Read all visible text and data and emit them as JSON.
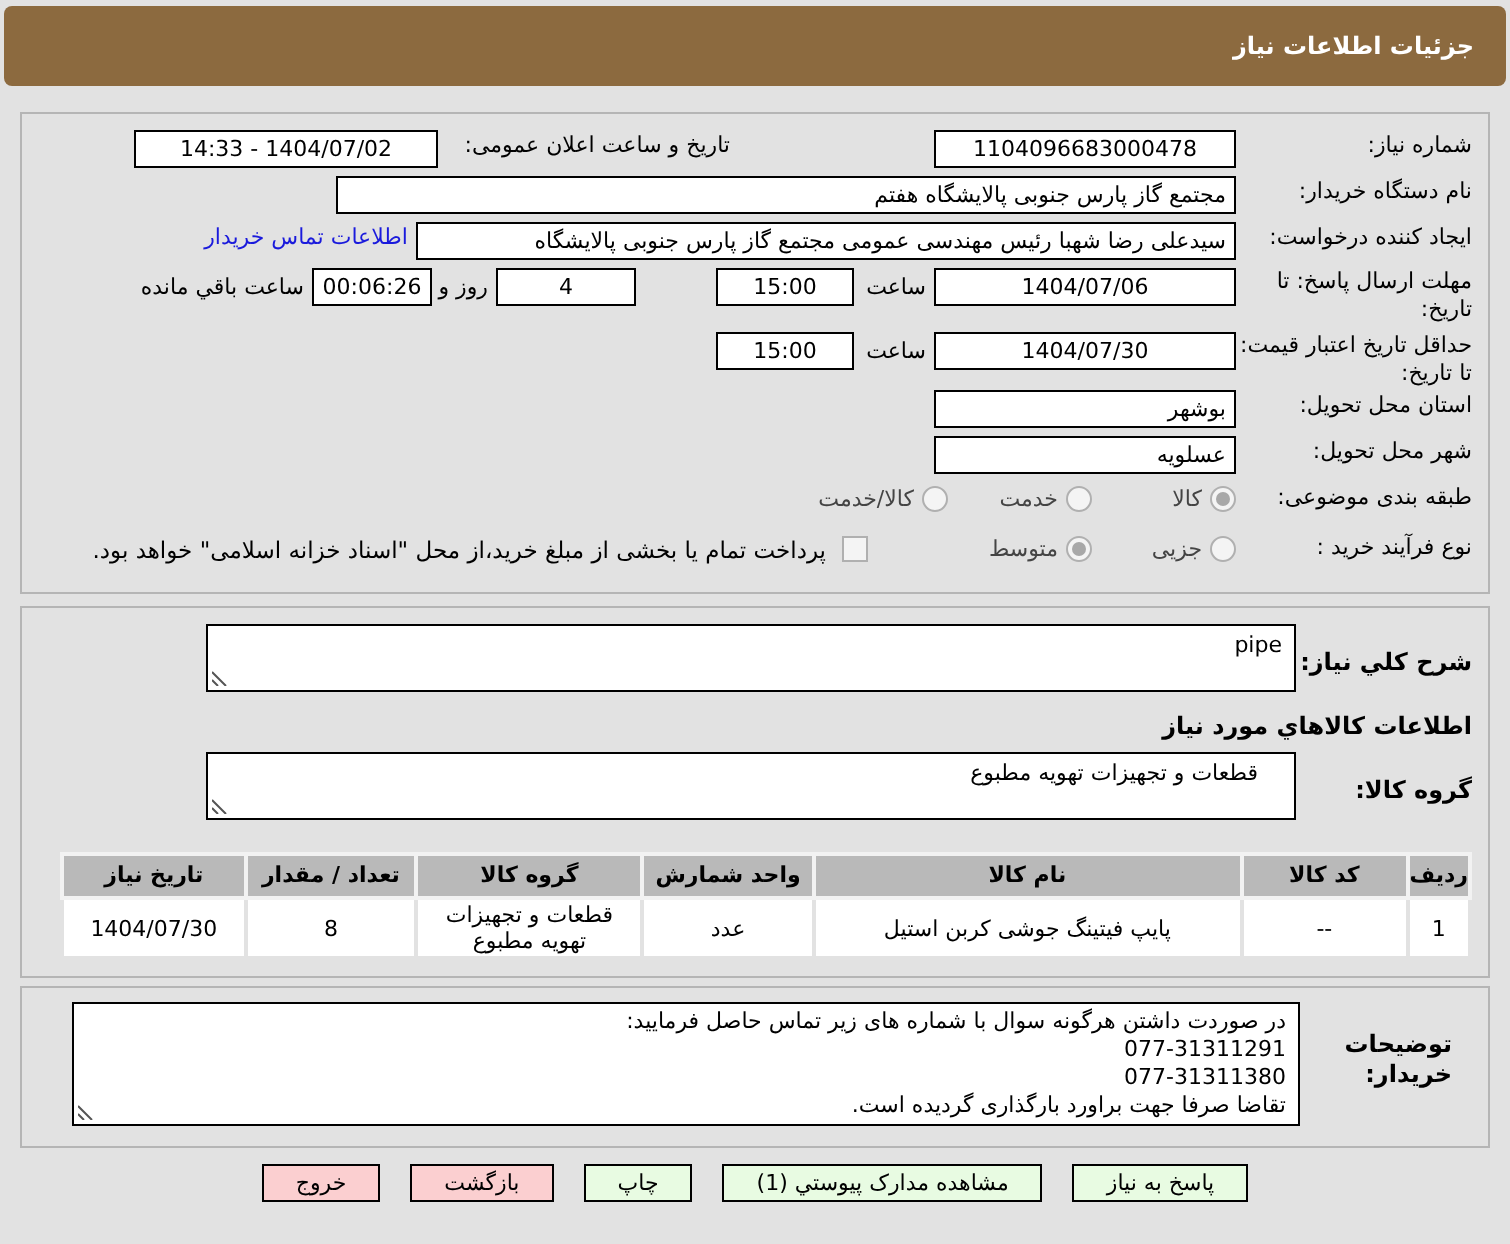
{
  "header": {
    "title": "جزئیات اطلاعات نیاز"
  },
  "form": {
    "need_number": {
      "label": "شماره نیاز:",
      "value": "1104096683000478"
    },
    "announce": {
      "label": "تاریخ و ساعت اعلان عمومی:",
      "value": "1404/07/02 - 14:33"
    },
    "buyer_org": {
      "label": "نام دستگاه خریدار:",
      "value": "مجتمع گاز پارس جنوبی  پالایشگاه هفتم"
    },
    "requester": {
      "label": "ایجاد کننده درخواست:",
      "value": "سیدعلی رضا شهبا رئیس مهندسی عمومی مجتمع گاز پارس جنوبی  پالایشگاه",
      "link": "اطلاعات تماس خریدار"
    },
    "reply_deadline": {
      "label": "مهلت ارسال پاسخ: تا تاریخ:",
      "date": "1404/07/06",
      "time_label": "ساعت",
      "time": "15:00",
      "days": "4",
      "days_label": "روز و",
      "remaining": "00:06:26",
      "remaining_label": "ساعت باقي مانده"
    },
    "price_validity": {
      "label": "حداقل تاریخ اعتبار قیمت: تا تاریخ:",
      "date": "1404/07/30",
      "time_label": "ساعت",
      "time": "15:00"
    },
    "province": {
      "label": "استان محل تحویل:",
      "value": "بوشهر"
    },
    "city": {
      "label": "شهر محل تحویل:",
      "value": "عسلویه"
    },
    "category": {
      "label": "طبقه بندی موضوعی:",
      "options": [
        {
          "label": "کالا",
          "selected": true
        },
        {
          "label": "خدمت",
          "selected": false
        },
        {
          "label": "کالا/خدمت",
          "selected": false
        }
      ]
    },
    "process": {
      "label": "نوع فرآیند خرید :",
      "options": [
        {
          "label": "جزیی",
          "selected": false
        },
        {
          "label": "متوسط",
          "selected": true
        }
      ],
      "payment": {
        "label": "پرداخت تمام یا بخشی از مبلغ خرید،از محل \"اسناد خزانه اسلامی\" خواهد بود.",
        "checked": false
      }
    }
  },
  "details": {
    "description": {
      "label": "شرح کلي نياز:",
      "value": "pipe"
    },
    "items_heading": "اطلاعات کالاهاي مورد نياز",
    "group": {
      "label": "گروه کالا:",
      "value": "قطعات و تجهیزات تهویه مطبوع"
    },
    "table": {
      "columns": [
        "ردیف",
        "کد کالا",
        "نام کالا",
        "واحد شمارش",
        "گروه کالا",
        "تعداد / مقدار",
        "تاریخ نیاز"
      ],
      "rows": [
        [
          "1",
          "--",
          "پایپ فیتینگ جوشی کربن استیل",
          "عدد",
          "قطعات و تجهیزات تهویه مطبوع",
          "8",
          "1404/07/30"
        ]
      ]
    }
  },
  "notes": {
    "label": "توضیحات خریدار:",
    "text": "در صوردت داشتن هرگونه سوال با شماره های زیر تماس حاصل فرمایید:\n077-31311291\n077-31311380\nتقاضا صرفا جهت براورد بارگذاری گردیده است."
  },
  "buttons": [
    {
      "label": "پاسخ به نیاز",
      "kind": "action"
    },
    {
      "label": "مشاهده مدارک پیوستي (1)",
      "kind": "action"
    },
    {
      "label": "چاپ",
      "kind": "action"
    },
    {
      "label": "بازگشت",
      "kind": "exit"
    },
    {
      "label": "خروج",
      "kind": "exit"
    }
  ]
}
